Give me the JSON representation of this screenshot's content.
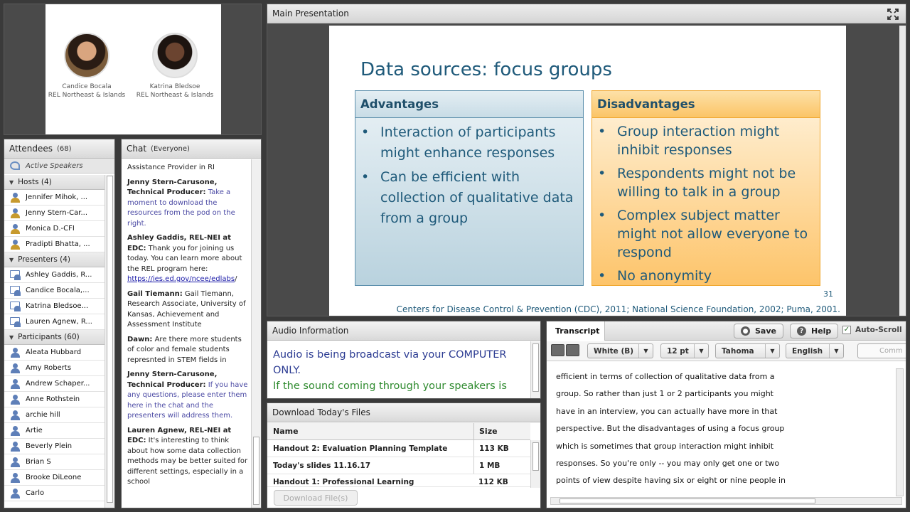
{
  "camera": {
    "person1_name": "Candice Bocala",
    "person1_org": "REL Northeast & Islands",
    "person2_name": "Katrina Bledsoe",
    "person2_org": "REL Northeast & Islands"
  },
  "attendees": {
    "title": "Attendees",
    "count": "(68)",
    "active_speakers": "Active Speakers",
    "groups": [
      {
        "label": "Hosts (4)",
        "members": [
          "Jennifer Mihok, ...",
          "Jenny Stern-Car...",
          "Monica D.-CFI",
          "Pradipti Bhatta, ..."
        ]
      },
      {
        "label": "Presenters (4)",
        "members": [
          "Ashley Gaddis, R...",
          "Candice Bocala,...",
          "Katrina Bledsoe...",
          "Lauren Agnew, R..."
        ]
      },
      {
        "label": "Participants (60)",
        "members": [
          "Aleata Hubbard",
          "Amy Roberts",
          "Andrew Schaper...",
          "Anne Rothstein",
          "archie hill",
          "Artie",
          "Beverly Plein",
          "Brian S",
          "Brooke DiLeone",
          "Carlo"
        ]
      }
    ]
  },
  "chat": {
    "title": "Chat",
    "scope": "(Everyone)",
    "messages": [
      {
        "who": "",
        "text": "Assistance Provider in RI"
      },
      {
        "who": "Jenny Stern-Carusone, Technical Producer:",
        "text": "Take a moment to download the resources from the pod on the right."
      },
      {
        "who": "Ashley Gaddis, REL-NEI at EDC:",
        "text": "Thank you for joining us today. You can learn more about the REL program here:",
        "link": "https://ies.ed.gov/ncee/edlabs",
        "after": "/"
      },
      {
        "who": "Gail Tiemann:",
        "text": "Gail Tiemann, Research Associate, University of Kansas, Achievement and Assessment Institute"
      },
      {
        "who": "Dawn:",
        "text": "Are there more students of color and female students represnted in STEM fields in"
      },
      {
        "who": "Jenny Stern-Carusone, Technical Producer:",
        "text": "If you have any questions, please enter them here in the chat and the presenters will address them."
      },
      {
        "who": "Lauren Agnew, REL-NEI at EDC:",
        "text": "It's interesting to think about how some data collection methods may be better suited for different settings, especially in a school"
      }
    ]
  },
  "main": {
    "title": "Main Presentation",
    "slide": {
      "title": "Data sources: focus groups",
      "adv_head": "Advantages",
      "adv_items": [
        "Interaction of participants might enhance responses",
        "Can be efficient with collection of qualitative data from a group"
      ],
      "dis_head": "Disadvantages",
      "dis_items": [
        "Group interaction might inhibit responses",
        "Respondents might not be willing to talk in a group",
        "Complex subject matter might not allow everyone to respond",
        "No anonymity"
      ],
      "number": "31",
      "citation": "Centers for Disease Control & Prevention (CDC), 2011; National Science Foundation, 2002; Puma, 2001."
    }
  },
  "audio": {
    "title": "Audio Information",
    "line1": "Audio is being broadcast via your COMPUTER ONLY.",
    "line2": "If the sound coming through your speakers is"
  },
  "files": {
    "title": "Download Today's Files",
    "col_name": "Name",
    "col_size": "Size",
    "rows": [
      {
        "name": "Handout 2: Evaluation Planning Template",
        "size": "113 KB"
      },
      {
        "name": "Today's slides 11.16.17",
        "size": "1 MB"
      },
      {
        "name": "Handout 1: Professional Learning",
        "size": "112 KB"
      }
    ],
    "download_label": "Download File(s)"
  },
  "transcript": {
    "tab": "Transcript",
    "save": "Save",
    "help": "Help",
    "autoscroll": "Auto-Scroll",
    "color": "White (B)",
    "size": "12 pt",
    "font": "Tahoma",
    "language": "English",
    "comm": "Comm",
    "lines": [
      "efficient in terms of collection of qualitative data from a",
      "group.  So rather than just 1 or 2 participants you might",
      "have in an interview, you can actually have more in that",
      "perspective.  But the disadvantages of using a focus group",
      "which is sometimes that group interaction might inhibit",
      "responses.  So you're only -- you may only get one or two",
      "points of view despite having six or eight or nine people in"
    ]
  }
}
